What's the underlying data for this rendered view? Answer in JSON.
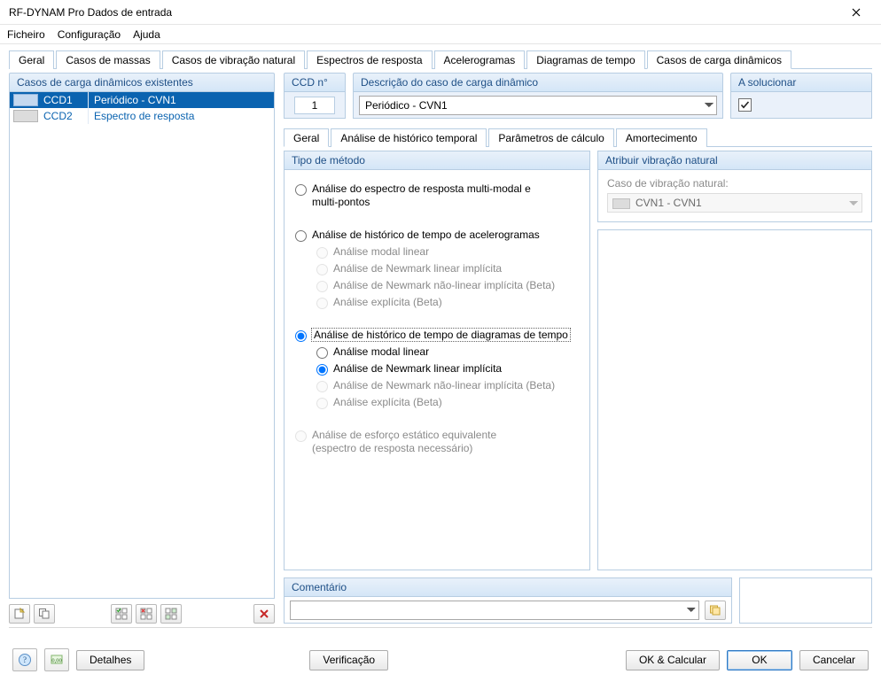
{
  "title": "RF-DYNAM Pro Dados de entrada",
  "menu": {
    "file": "Ficheiro",
    "config": "Configuração",
    "help": "Ajuda"
  },
  "main_tabs": [
    "Geral",
    "Casos de massas",
    "Casos de vibração natural",
    "Espectros de resposta",
    "Acelerogramas",
    "Diagramas de tempo",
    "Casos de carga dinâmicos"
  ],
  "main_tab_active": 6,
  "leftpanel": {
    "header": "Casos de carga dinâmicos existentes",
    "rows": [
      {
        "id": "CCD1",
        "desc": "Periódico - CVN1",
        "selected": true
      },
      {
        "id": "CCD2",
        "desc": "Espectro de resposta",
        "selected": false
      }
    ]
  },
  "ccd_no": {
    "label": "CCD n°",
    "value": "1"
  },
  "case_desc": {
    "label": "Descrição do caso de carga dinâmico",
    "value": "Periódico - CVN1"
  },
  "solve": {
    "label": "A solucionar",
    "checked": true
  },
  "sub_tabs": [
    "Geral",
    "Análise de histórico temporal",
    "Parâmetros de cálculo",
    "Amortecimento"
  ],
  "sub_tab_active": 0,
  "method": {
    "header": "Tipo de método",
    "opt_spectrum": "Análise do espectro de resposta multi-modal e multi-pontos",
    "opt_accel": "Análise de histórico de tempo de acelerogramas",
    "accel_sub": [
      "Análise modal linear",
      "Análise de Newmark linear implícita",
      "Análise de Newmark não-linear implícita (Beta)",
      "Análise explícita (Beta)"
    ],
    "opt_timedg": "Análise de histórico de tempo de diagramas de tempo",
    "timedg_sub": {
      "a": "Análise modal linear",
      "b": "Análise de Newmark linear implícita",
      "c": "Análise de Newmark não-linear implícita (Beta)",
      "d": "Análise explícita (Beta)"
    },
    "opt_equiv": "Análise de esforço estático equivalente",
    "opt_equiv2": "(espectro de resposta necessário)"
  },
  "natvib": {
    "header": "Atribuir vibração natural",
    "label": "Caso de vibração natural:",
    "value": "CVN1 - CVN1"
  },
  "comment": {
    "header": "Comentário",
    "value": ""
  },
  "buttons": {
    "details": "Detalhes",
    "verify": "Verificação",
    "ok_calc": "OK & Calcular",
    "ok": "OK",
    "cancel": "Cancelar"
  }
}
